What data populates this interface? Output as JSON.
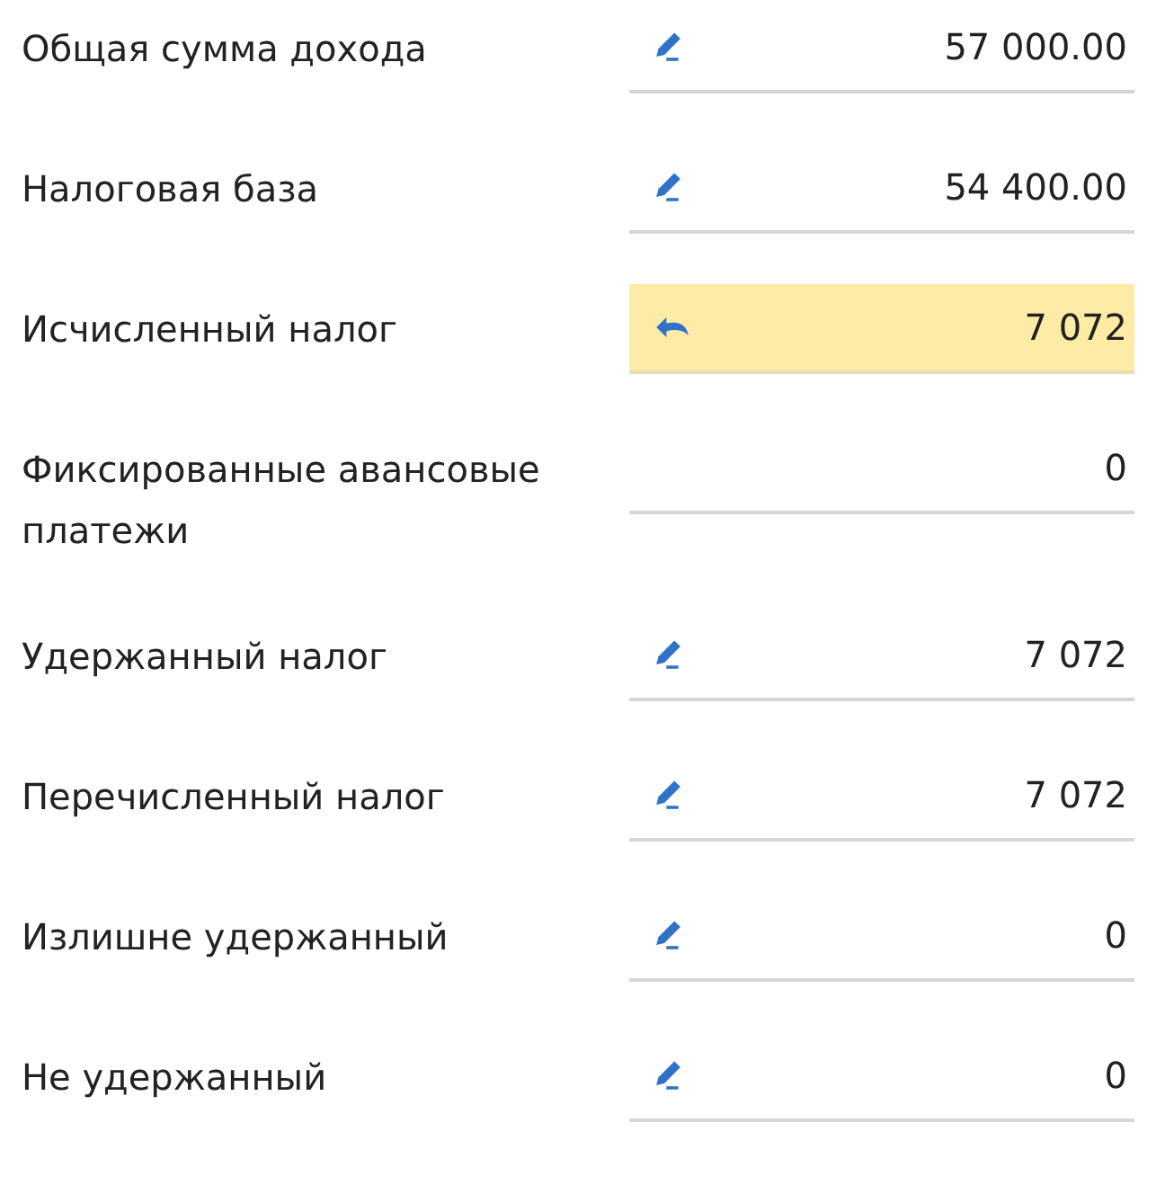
{
  "rows": [
    {
      "label": "Общая сумма дохода",
      "kind": "edit",
      "value": "57 000.00",
      "modified": false
    },
    {
      "label": "Налоговая база",
      "kind": "edit",
      "value": "54 400.00",
      "modified": false
    },
    {
      "label": "Исчисленный налог",
      "kind": "undo",
      "value": "7 072",
      "modified": true
    },
    {
      "label": "Фиксированные авансовые платежи",
      "kind": "plain",
      "value": "0",
      "modified": false
    },
    {
      "label": "Удержанный налог",
      "kind": "edit",
      "value": "7 072",
      "modified": false
    },
    {
      "label": "Перечисленный налог",
      "kind": "edit",
      "value": "7 072",
      "modified": false
    },
    {
      "label": "Излишне удержанный",
      "kind": "edit",
      "value": "0",
      "modified": false
    },
    {
      "label": "Не удержанный",
      "kind": "edit",
      "value": "0",
      "modified": false
    }
  ]
}
